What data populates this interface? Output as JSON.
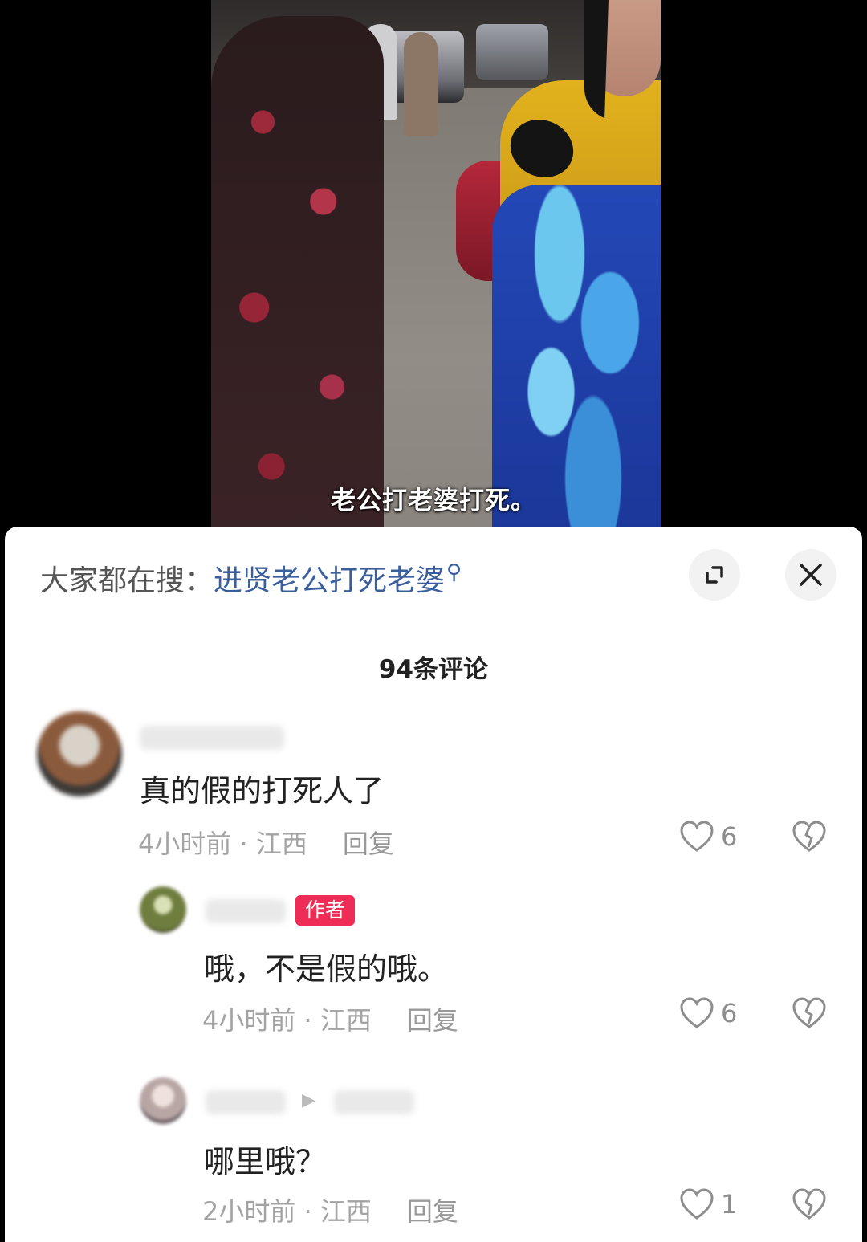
{
  "video": {
    "subtitle": "老公打老婆打死。"
  },
  "sheet": {
    "search_prefix": "大家都在搜：",
    "search_query": "进贤老公打死老婆",
    "comment_count": "94条评论",
    "icons": {
      "search": "search-icon",
      "expand": "expand-icon",
      "close": "close-icon",
      "like": "heart-icon",
      "dislike": "broken-heart-icon"
    }
  },
  "comments": [
    {
      "text": "真的假的打死人了",
      "time": "4小时前 · 江西",
      "reply_label": "回复",
      "likes": "6"
    },
    {
      "badge": "作者",
      "text": "哦，不是假的哦。",
      "time": "4小时前 · 江西",
      "reply_label": "回复",
      "likes": "6"
    },
    {
      "text": "哪里哦？",
      "time": "2小时前 · 江西",
      "reply_label": "回复",
      "likes": "1"
    }
  ],
  "colors": {
    "author_badge": "#ee2c55",
    "search_query": "#3a5f9f",
    "meta_text": "#a3a3a3"
  }
}
